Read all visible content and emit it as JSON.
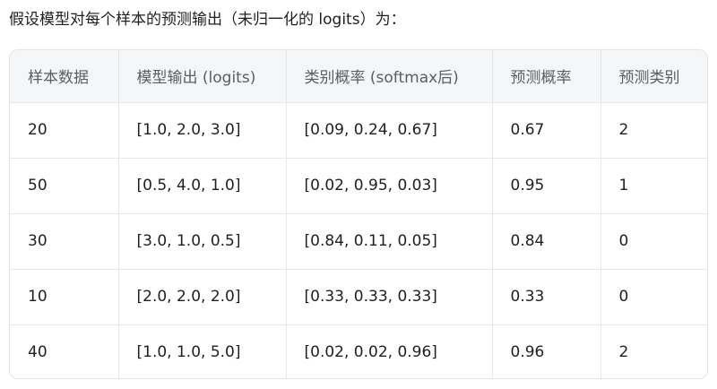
{
  "intro_text": "假设模型对每个样本的预测输出（未归一化的 logits）为：",
  "table": {
    "headers": [
      "样本数据",
      "模型输出 (logits)",
      "类别概率 (softmax后)",
      "预测概率",
      "预测类别"
    ],
    "rows": [
      [
        "20",
        "[1.0, 2.0, 3.0]",
        "[0.09, 0.24, 0.67]",
        "0.67",
        "2"
      ],
      [
        "50",
        "[0.5, 4.0, 1.0]",
        "[0.02, 0.95, 0.03]",
        "0.95",
        "1"
      ],
      [
        "30",
        "[3.0, 1.0, 0.5]",
        "[0.84, 0.11, 0.05]",
        "0.84",
        "0"
      ],
      [
        "10",
        "[2.0, 2.0, 2.0]",
        "[0.33, 0.33, 0.33]",
        "0.33",
        "0"
      ],
      [
        "40",
        "[1.0, 1.0, 5.0]",
        "[0.02, 0.02, 0.96]",
        "0.96",
        "2"
      ]
    ]
  }
}
